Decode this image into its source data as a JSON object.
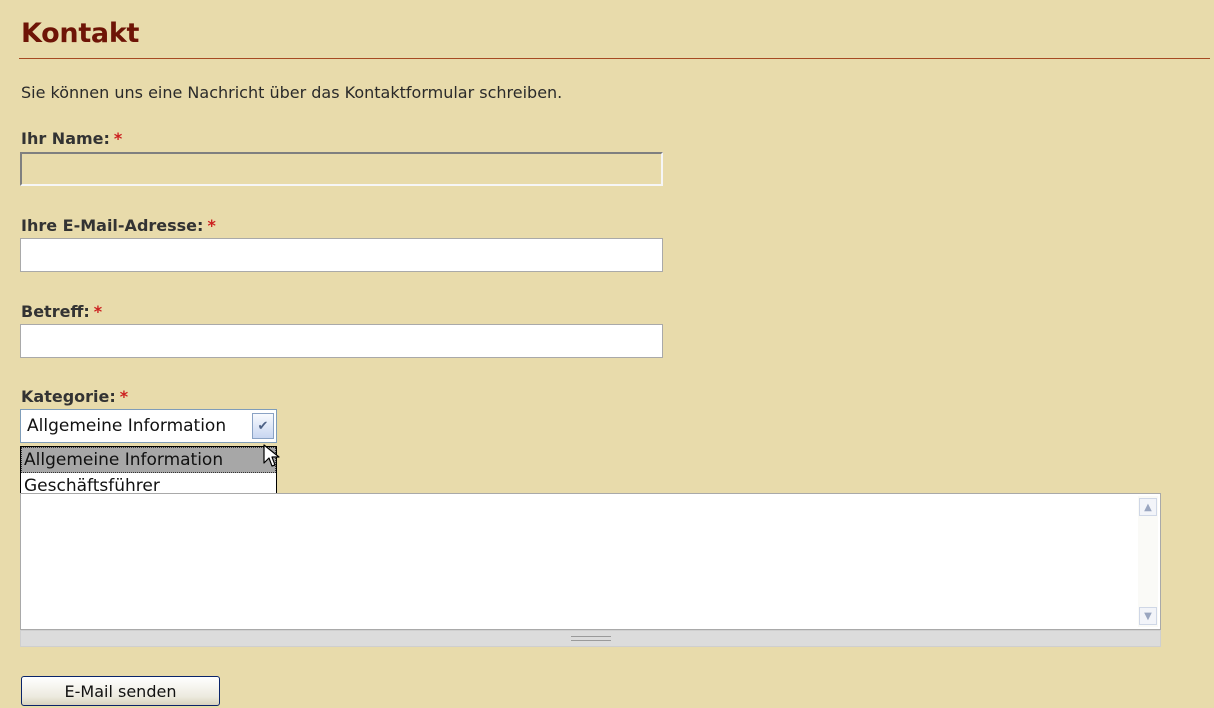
{
  "page": {
    "title": "Kontakt",
    "intro": "Sie können uns eine Nachricht über das Kontaktformular schreiben."
  },
  "form": {
    "required_marker": "*",
    "name_label": "Ihr Name:",
    "email_label": "Ihre E-Mail-Adresse:",
    "subject_label": "Betreff:",
    "category_label": "Kategorie:",
    "category_selected": "Allgemeine Information",
    "category_options": [
      "Allgemeine Information",
      "Geschäftsführer"
    ],
    "submit_label": "E-Mail senden"
  },
  "icons": {
    "select_arrow": "chevron-down-icon",
    "scroll_up": "scroll-up-icon",
    "scroll_down": "scroll-down-icon",
    "cursor": "mouse-pointer-icon"
  },
  "colors": {
    "background": "#e8dbab",
    "title": "#6e1406",
    "required": "#cc1f1f",
    "rule": "#a64a22"
  }
}
